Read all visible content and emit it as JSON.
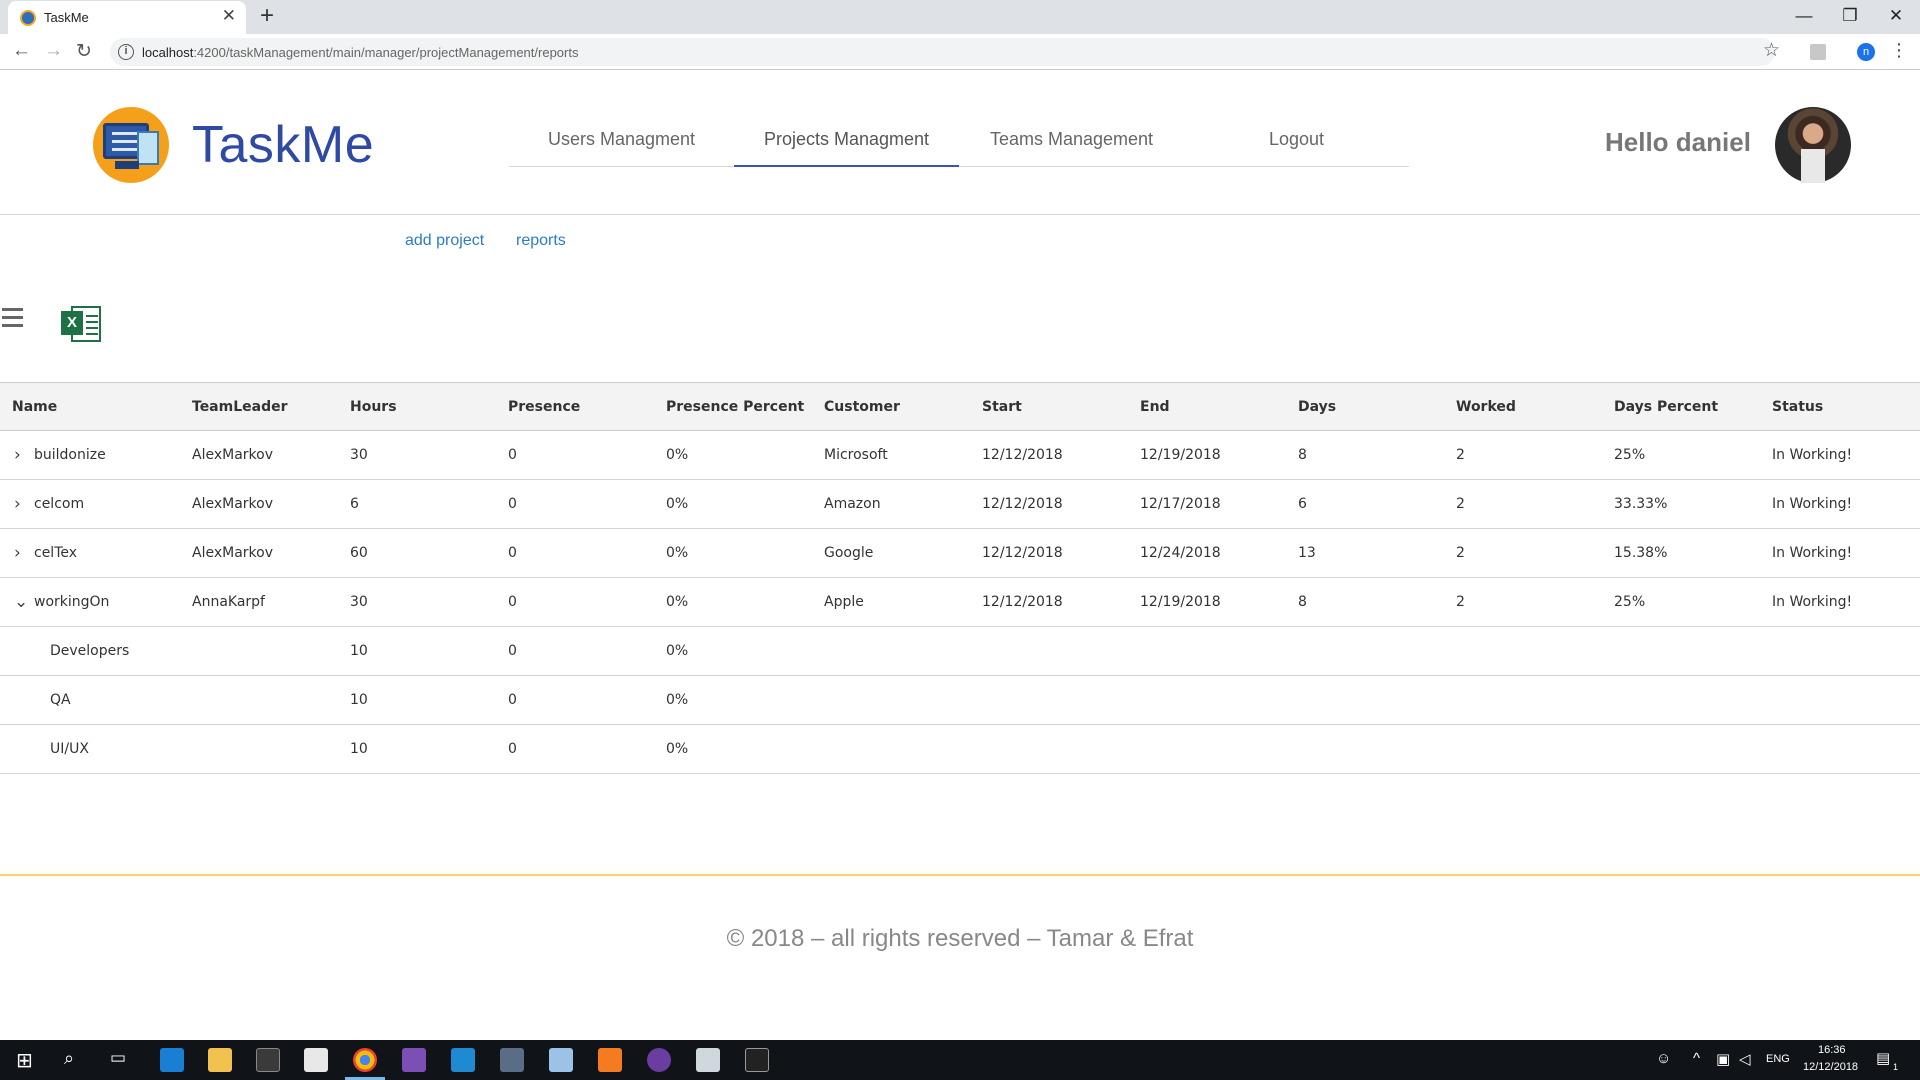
{
  "browser": {
    "tab_title": "TaskMe",
    "tab_close": "✕",
    "new_tab": "+",
    "url_host": "localhost",
    "url_path": ":4200/taskManagement/main/manager/projectManagement/reports",
    "profile_initial": "n",
    "window_controls": {
      "minimize": "—",
      "restore": "❐",
      "close": "✕"
    }
  },
  "header": {
    "brand": "TaskMe",
    "nav": [
      {
        "label": "Users Managment",
        "active": false
      },
      {
        "label": "Projects Managment",
        "active": true
      },
      {
        "label": "Teams Management",
        "active": false
      },
      {
        "label": "Logout",
        "active": false
      }
    ],
    "greeting": "Hello daniel"
  },
  "subnav": {
    "add_project": "add project",
    "reports": "reports"
  },
  "table": {
    "columns": [
      "Name",
      "TeamLeader",
      "Hours",
      "Presence",
      "Presence Percent",
      "Customer",
      "Start",
      "End",
      "Days",
      "Worked",
      "Days Percent",
      "Status"
    ],
    "rows": [
      {
        "toggle": ">",
        "expanded": false,
        "cells": [
          "buildonize",
          "AlexMarkov",
          "30",
          "0",
          "0%",
          "Microsoft",
          "12/12/2018",
          "12/19/2018",
          "8",
          "2",
          "25%",
          "In Working!"
        ]
      },
      {
        "toggle": ">",
        "expanded": false,
        "cells": [
          "celcom",
          "AlexMarkov",
          "6",
          "0",
          "0%",
          "Amazon",
          "12/12/2018",
          "12/17/2018",
          "6",
          "2",
          "33.33%",
          "In Working!"
        ]
      },
      {
        "toggle": ">",
        "expanded": false,
        "cells": [
          "celTex",
          "AlexMarkov",
          "60",
          "0",
          "0%",
          "Google",
          "12/12/2018",
          "12/24/2018",
          "13",
          "2",
          "15.38%",
          "In Working!"
        ]
      },
      {
        "toggle": "⌄",
        "expanded": true,
        "cells": [
          "workingOn",
          "AnnaKarpf",
          "30",
          "0",
          "0%",
          "Apple",
          "12/12/2018",
          "12/19/2018",
          "8",
          "2",
          "25%",
          "In Working!"
        ]
      }
    ],
    "subrows": [
      {
        "cells": [
          "Developers",
          "",
          "10",
          "0",
          "0%",
          "",
          "",
          "",
          "",
          "",
          "",
          ""
        ]
      },
      {
        "cells": [
          "QA",
          "",
          "10",
          "0",
          "0%",
          "",
          "",
          "",
          "",
          "",
          "",
          ""
        ]
      },
      {
        "cells": [
          "UI/UX",
          "",
          "10",
          "0",
          "0%",
          "",
          "",
          "",
          "",
          "",
          "",
          ""
        ]
      }
    ]
  },
  "footer": {
    "copyright": "© 2018 – all rights reserved – Tamar & Efrat"
  },
  "taskbar": {
    "language": "ENG",
    "time": "16:36",
    "date": "12/12/2018",
    "notifications": "1"
  }
}
